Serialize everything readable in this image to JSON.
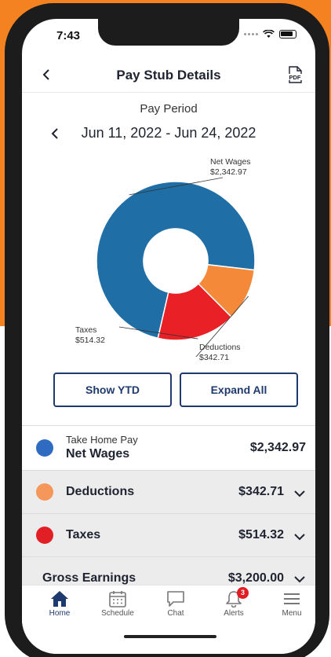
{
  "status": {
    "time": "7:43"
  },
  "header": {
    "title": "Pay Stub Details",
    "pdf_label": "PDF"
  },
  "pay_period": {
    "label": "Pay Period",
    "range": "Jun 11, 2022 - Jun 24, 2022"
  },
  "chart_data": {
    "type": "pie",
    "categories": [
      "Net Wages",
      "Deductions",
      "Taxes"
    ],
    "values": [
      2342.97,
      342.71,
      514.32
    ],
    "value_labels": [
      "$2,342.97",
      "$342.71",
      "$514.32"
    ],
    "colors": [
      "#1f6ea6",
      "#f5893a",
      "#ea2027"
    ]
  },
  "buttons": {
    "show_ytd": "Show YTD",
    "expand_all": "Expand All"
  },
  "rows": {
    "net": {
      "small": "Take Home Pay",
      "label": "Net Wages",
      "amount": "$2,342.97",
      "color": "#2f6bc0"
    },
    "deductions": {
      "label": "Deductions",
      "amount": "$342.71",
      "color": "#f5975a"
    },
    "taxes": {
      "label": "Taxes",
      "amount": "$514.32",
      "color": "#e11f25"
    },
    "gross": {
      "label": "Gross Earnings",
      "amount": "$3,200.00"
    }
  },
  "tabs": {
    "home": "Home",
    "schedule": "Schedule",
    "chat": "Chat",
    "alerts": "Alerts",
    "alerts_badge": "3",
    "menu": "Menu"
  },
  "colors": {
    "accent": "#f58220",
    "brand": "#1f3a6e"
  }
}
